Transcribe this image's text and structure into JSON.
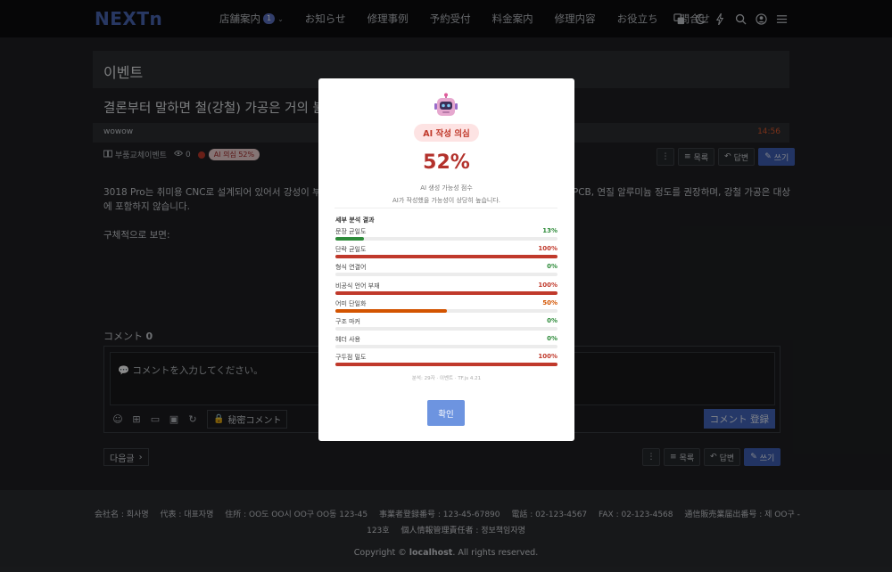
{
  "header": {
    "logo": "NEXTn",
    "nav": [
      {
        "label": "店舗案内",
        "badge": "1",
        "caret": "⌄"
      },
      {
        "label": "お知らせ"
      },
      {
        "label": "修理事例"
      },
      {
        "label": "予約受付"
      },
      {
        "label": "料金案内"
      },
      {
        "label": "修理内容"
      },
      {
        "label": "お役立ち"
      },
      {
        "label": "問合せ"
      }
    ],
    "icons": [
      "translate-icon",
      "dark-mode-icon",
      "bolt-icon",
      "search-icon",
      "user-icon",
      "menu-icon"
    ]
  },
  "board": {
    "title": "이벤트",
    "post_title": "결론부터 말하면 철(강철) 가공은 거의 불가능합",
    "author": "wowow",
    "time": "14:56",
    "category": "부품교체이벤트",
    "views": "0",
    "ai_chip": "AI 의심 52%",
    "body_line1": "3018 Pro는 취미용 CNC로 설계되어 있어서 강성이 부족하고",
    "body_line1_tail": "틱, PCB, 연질 알루미늄 정도를 권장하며, 강철 가공은 대상",
    "body_line2": "에 포함하지 않습니다.",
    "body_line3": "구체적으로 보면:",
    "btn_more": "⋮",
    "btn_list": "목록",
    "btn_reply": "답변",
    "btn_write": "쓰기"
  },
  "comments": {
    "title": "コメント",
    "count": "0",
    "placeholder": "コメントを入力してください。",
    "secret": "秘密コメント",
    "submit": "コメント 登録"
  },
  "nav_bottom": {
    "next": "다음글"
  },
  "footer": {
    "company": "会社名 : 회사명",
    "rep": "代表 : 대표자명",
    "address": "住所 : OO도 OO시 OO구 OO동 123-45",
    "biz_no": "事業者登録番号 : 123-45-67890",
    "phone": "電話 : 02-123-4567",
    "fax": "FAX : 02-123-4568",
    "mail_order": "通信販売業届出番号 : 제 OO구 -",
    "line2_a": "123호",
    "line2_b": "個人情報管理責任者 : 정보책임자명",
    "copy_pre": "Copyright ©",
    "copy_host": "localhost",
    "copy_post": ". All rights reserved."
  },
  "modal": {
    "status": "AI 작성 의심",
    "score": "52%",
    "score_label": "AI 생성 가능성 점수",
    "score_desc": "AI가 작성했을 가능성이 상당히 높습니다.",
    "detail_title": "세부 분석 결과",
    "metrics": [
      {
        "name": "문장 균일도",
        "value": "13%",
        "pct": 13,
        "color": "#2e8b3a"
      },
      {
        "name": "단락 균일도",
        "value": "100%",
        "pct": 100,
        "color": "#c0392b"
      },
      {
        "name": "형식 연결어",
        "value": "0%",
        "pct": 0,
        "color": "#2e8b3a"
      },
      {
        "name": "비공식 언어 부재",
        "value": "100%",
        "pct": 100,
        "color": "#c0392b"
      },
      {
        "name": "어미 단일화",
        "value": "50%",
        "pct": 50,
        "color": "#d35400"
      },
      {
        "name": "구조 마커",
        "value": "0%",
        "pct": 0,
        "color": "#2e8b3a"
      },
      {
        "name": "헤더 사용",
        "value": "0%",
        "pct": 0,
        "color": "#2e8b3a"
      },
      {
        "name": "구두점 밀도",
        "value": "100%",
        "pct": 100,
        "color": "#c0392b"
      }
    ],
    "footnote": "분석: 29자 · 이벤트 · TF.js 4.21",
    "ok": "확인"
  }
}
